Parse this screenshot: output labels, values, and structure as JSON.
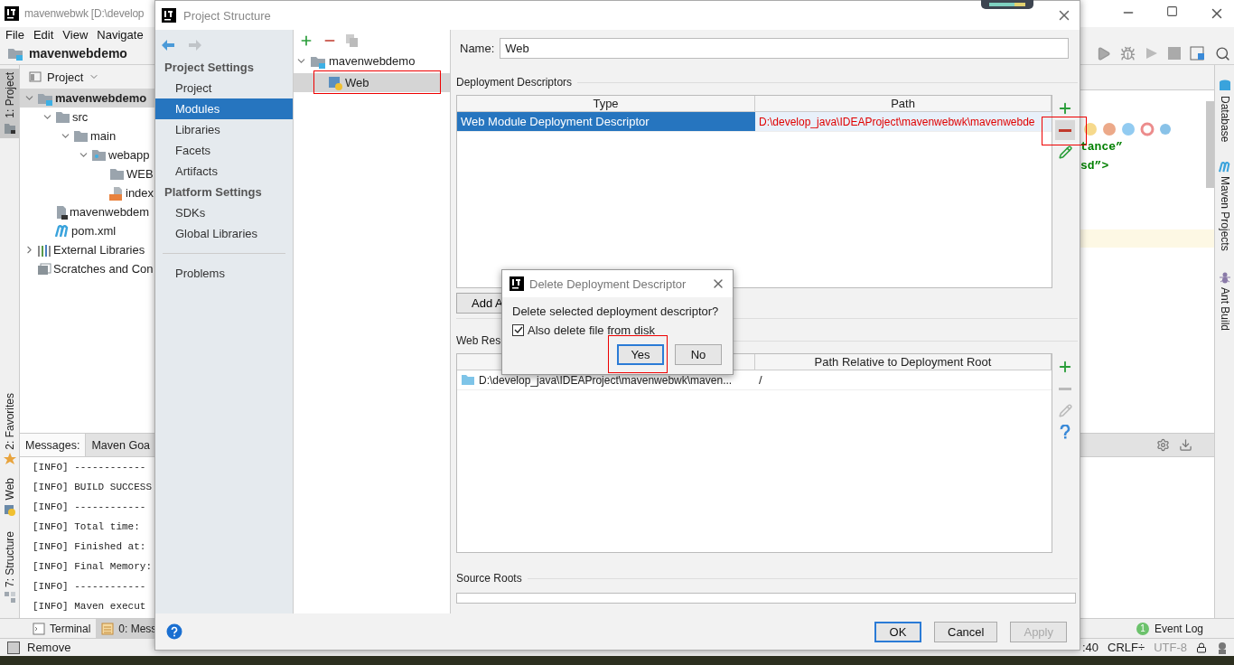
{
  "ide": {
    "title": "mavenwebwk [D:\\develop",
    "menu": [
      "File",
      "Edit",
      "View",
      "Navigate"
    ],
    "breadcrumb": "mavenwebdemo",
    "left_tool_tabs": [
      {
        "label": "1: Project",
        "kind": "project",
        "selected": true
      },
      {
        "label": "2: Favorites",
        "kind": "favorites",
        "selected": false
      },
      {
        "label": "Web",
        "kind": "web",
        "selected": false
      },
      {
        "label": "7: Structure",
        "kind": "structure",
        "selected": false
      }
    ],
    "right_tool_tabs": [
      {
        "label": "Database",
        "kind": "database"
      },
      {
        "label": "Maven Projects",
        "kind": "maven"
      },
      {
        "label": "Ant Build",
        "kind": "ant"
      }
    ],
    "project_panel": {
      "title": "Project",
      "tree": [
        {
          "label": "mavenwebdemo",
          "kind": "module",
          "selected": true,
          "expanded": true,
          "children": [
            {
              "label": "src",
              "kind": "folder",
              "selected": false,
              "expanded": true,
              "children": [
                {
                  "label": "main",
                  "kind": "folder",
                  "selected": false,
                  "expanded": true,
                  "children": [
                    {
                      "label": "webapp",
                      "kind": "webfolder",
                      "selected": false,
                      "expanded": true,
                      "children": [
                        {
                          "label": "WEB",
                          "kind": "folder",
                          "selected": false
                        },
                        {
                          "label": "index",
                          "kind": "jsp",
                          "selected": false
                        }
                      ]
                    }
                  ]
                }
              ]
            },
            {
              "label": "mavenwebdem",
              "kind": "iml",
              "selected": false
            },
            {
              "label": "pom.xml",
              "kind": "pom",
              "selected": false
            }
          ]
        },
        {
          "label": "External Libraries",
          "kind": "libraries",
          "selected": false,
          "expanded": false
        },
        {
          "label": "Scratches and Con",
          "kind": "scratches",
          "selected": false
        }
      ]
    },
    "editor_fragments": [
      "tance”",
      "sd”>"
    ],
    "messages": {
      "tabs": [
        {
          "label": "Messages:",
          "selected": true
        },
        {
          "label": "Maven Goa",
          "selected": false
        }
      ],
      "lines": [
        "[INFO] ------------",
        "[INFO] BUILD SUCCESS",
        "[INFO] ------------",
        "[INFO] Total time: ",
        "[INFO] Finished at:",
        "[INFO] Final Memory:",
        "[INFO] ------------",
        "[INFO] Maven execut"
      ]
    },
    "tool_buttons": [
      {
        "label": "Terminal",
        "kind": "terminal",
        "selected": false
      },
      {
        "label": "0: Mess",
        "kind": "messages",
        "selected": true
      }
    ],
    "event_log": {
      "badge": "1",
      "label": "Event Log"
    },
    "status": {
      "message": "Remove",
      "position": ":40",
      "line_separator": "CRLF÷",
      "encoding": "UTF-8"
    }
  },
  "dialog": {
    "title": "Project Structure",
    "sidebar": {
      "sections": [
        {
          "title": "Project Settings",
          "items": [
            {
              "label": "Project",
              "selected": false
            },
            {
              "label": "Modules",
              "selected": true
            },
            {
              "label": "Libraries",
              "selected": false
            },
            {
              "label": "Facets",
              "selected": false
            },
            {
              "label": "Artifacts",
              "selected": false
            }
          ]
        },
        {
          "title": "Platform Settings",
          "items": [
            {
              "label": "SDKs",
              "selected": false
            },
            {
              "label": "Global Libraries",
              "selected": false
            }
          ]
        }
      ],
      "extra_items": [
        {
          "label": "Problems",
          "selected": false
        }
      ]
    },
    "module_tree": [
      {
        "label": "mavenwebdemo",
        "kind": "module",
        "selected": false,
        "highlighted": false,
        "expanded": true,
        "children": [
          {
            "label": "Web",
            "kind": "web",
            "selected": true,
            "highlighted": true
          }
        ]
      }
    ],
    "name_label": "Name:",
    "name_value": "Web",
    "descriptors": {
      "title": "Deployment Descriptors",
      "columns": [
        "Type",
        "Path"
      ],
      "rows": [
        {
          "type": "Web Module Deployment Descriptor",
          "path": "D:\\develop_java\\IDEAProject\\mavenwebwk\\mavenwebde",
          "invalid": true,
          "selected": true
        }
      ],
      "tools": [
        {
          "kind": "add",
          "disabled": false,
          "highlighted": false
        },
        {
          "kind": "remove",
          "disabled": false,
          "highlighted": true
        },
        {
          "kind": "edit",
          "disabled": false,
          "highlighted": false
        }
      ]
    },
    "add_button": "Add A",
    "resources": {
      "title": "Web Res",
      "column_2_header": "Path Relative to Deployment Root",
      "rows": [
        {
          "column_1": "D:\\develop_java\\IDEAProject\\mavenwebwk\\maven...",
          "column_2": "/"
        }
      ],
      "tools": [
        {
          "kind": "add",
          "disabled": false,
          "highlighted": false
        },
        {
          "kind": "remove",
          "disabled": true,
          "highlighted": false
        },
        {
          "kind": "edit",
          "disabled": true,
          "highlighted": false
        },
        {
          "kind": "help",
          "disabled": false,
          "highlighted": false
        }
      ]
    },
    "source_roots": {
      "title": "Source Roots"
    },
    "buttons": [
      {
        "label": "OK",
        "default": true,
        "disabled": false
      },
      {
        "label": "Cancel",
        "default": false,
        "disabled": false
      },
      {
        "label": "Apply",
        "default": false,
        "disabled": true
      }
    ]
  },
  "confirm": {
    "title": "Delete Deployment Descriptor",
    "message": "Delete selected deployment descriptor?",
    "checkbox": {
      "label": "Also delete file from disk",
      "checked": true
    },
    "buttons": [
      {
        "label": "Yes",
        "default": true,
        "highlighted": true
      },
      {
        "label": "No",
        "default": false,
        "highlighted": false
      }
    ]
  }
}
